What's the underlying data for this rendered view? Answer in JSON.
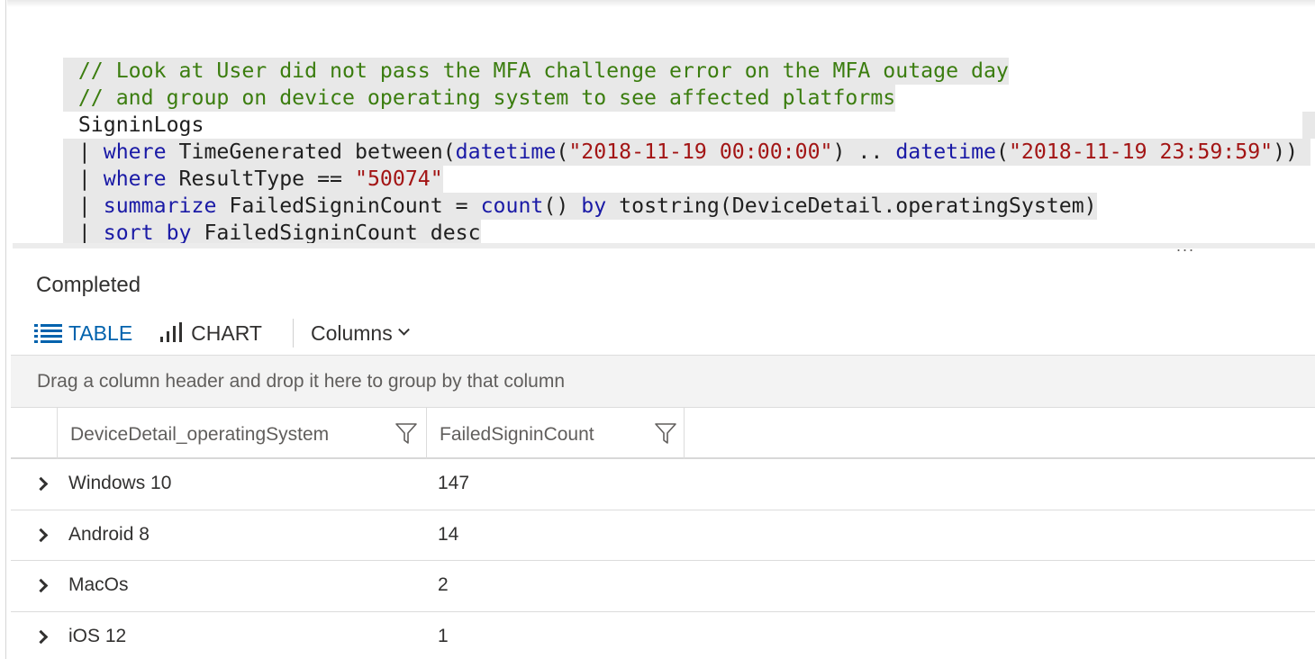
{
  "query": {
    "comment1": "// Look at User did not pass the MFA challenge error on the MFA outage day",
    "comment2": "// and group on device operating system to see affected platforms",
    "table_name": "SigninLogs",
    "line1": {
      "pipe": "| ",
      "kw": "where",
      "t1": " TimeGenerated between(",
      "fn1": "datetime",
      "t2": "(",
      "s1": "\"2018-11-19 00:00:00\"",
      "t3": ") .. ",
      "fn2": "datetime",
      "t4": "(",
      "s2": "\"2018-11-19 23:59:59\"",
      "t5": "))"
    },
    "line2": {
      "pipe": "| ",
      "kw": "where",
      "t1": " ResultType == ",
      "s1": "\"50074\""
    },
    "line3": {
      "pipe": "| ",
      "kw": "summarize",
      "t1": " FailedSigninCount = ",
      "fn1": "count",
      "t2": "() ",
      "kw2": "by",
      "t3": " tostring(DeviceDetail.operatingSystem)"
    },
    "line4": {
      "pipe": "| ",
      "kw": "sort by",
      "t1": " FailedSigninCount desc"
    },
    "more": "..."
  },
  "results": {
    "status": "Completed",
    "toolbar": {
      "table_label": "TABLE",
      "chart_label": "CHART",
      "columns_label": "Columns"
    },
    "group_hint": "Drag a column header and drop it here to group by that column",
    "columns": [
      "DeviceDetail_operatingSystem",
      "FailedSigninCount"
    ],
    "rows": [
      {
        "os": "Windows 10",
        "count": "147"
      },
      {
        "os": "Android 8",
        "count": "14"
      },
      {
        "os": "MacOs",
        "count": "2"
      },
      {
        "os": "iOS 12",
        "count": "1"
      }
    ]
  },
  "colors": {
    "accent": "#0062ad",
    "comment": "#3b7d0f",
    "keyword": "#1a1aa6",
    "string": "#a31515"
  },
  "icons": [
    "table-list-icon",
    "chart-bars-icon",
    "chevron-down-icon",
    "filter-icon",
    "expand-chevron-icon"
  ]
}
